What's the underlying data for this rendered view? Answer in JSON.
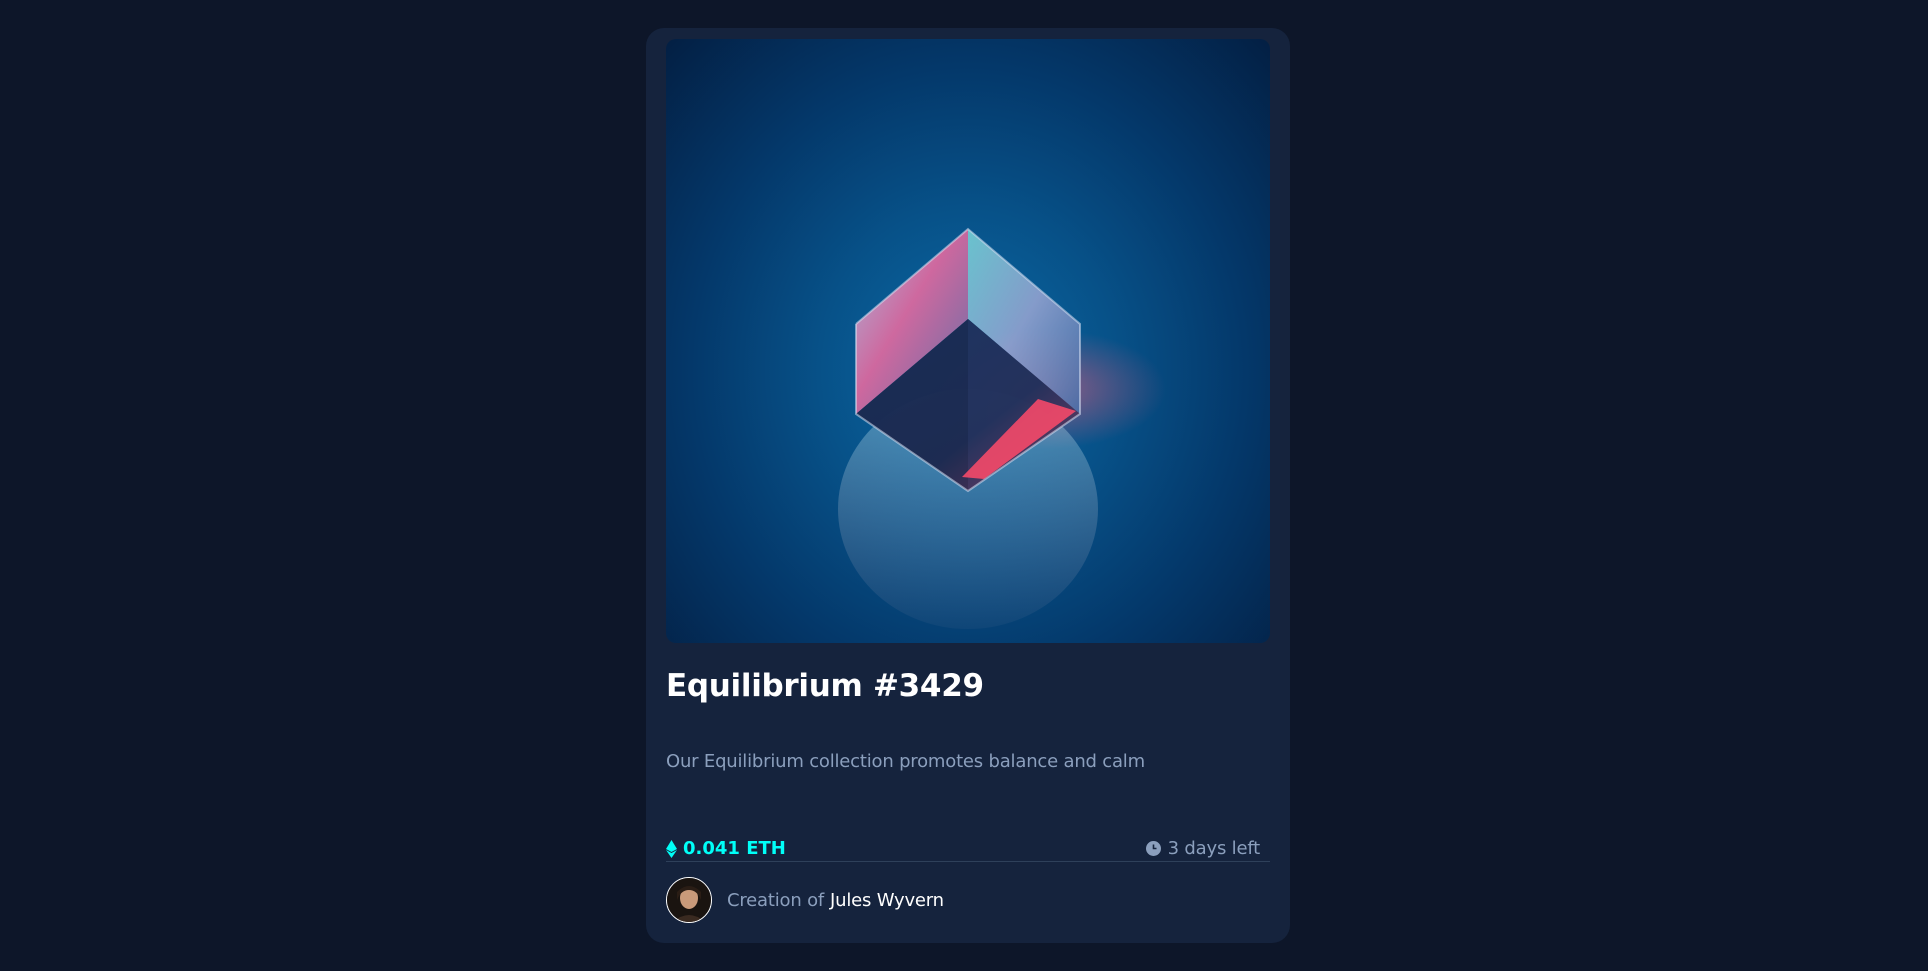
{
  "card": {
    "image": {
      "icon": "crystal-cube-image"
    },
    "title": "Equilibrium #3429",
    "description": "Our Equilibrium collection promotes balance and calm",
    "price": {
      "icon": "ethereum-icon",
      "value": "0.041 ETH"
    },
    "time_left": {
      "icon": "clock-icon",
      "value": "3 days left"
    },
    "creator": {
      "avatar": "avatar",
      "prefix": "Creation of",
      "name": "Jules Wyvern"
    }
  },
  "colors": {
    "page_bg": "#0d1629",
    "card_bg": "#15233d",
    "accent_cyan": "#00fff8",
    "text_muted": "#8b9fbd",
    "text_white": "#ffffff",
    "divider": "#2e405a"
  }
}
